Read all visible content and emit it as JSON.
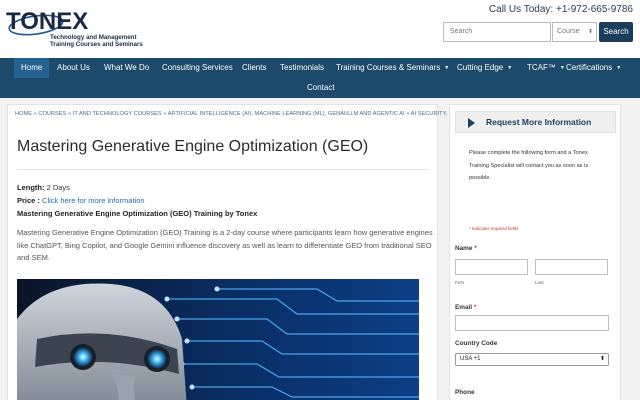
{
  "header": {
    "logo_word": "TONEX",
    "logo_line1": "Technology and Management",
    "logo_line2": "Training Courses and Seminars",
    "phone": "Call Us Today: +1-972-665-9786",
    "search_placeholder": "Search",
    "course_select": "Course",
    "search_button": "Search"
  },
  "nav": {
    "items": [
      {
        "label": "Home"
      },
      {
        "label": "About Us"
      },
      {
        "label": "What We Do"
      },
      {
        "label": "Consulting Services"
      },
      {
        "label": "Clients"
      },
      {
        "label": "Testimonials"
      },
      {
        "label": "Training Courses & Seminars"
      },
      {
        "label": "Cutting Edge"
      },
      {
        "label": "TCAF™"
      },
      {
        "label": "Certifications"
      },
      {
        "label": "Contact"
      }
    ],
    "caret": "▼"
  },
  "main": {
    "breadcrumb": "HOME » COURSES » IT AND TECHNOLOGY COURSES » ARTIFICIAL INTELLIGENCE (AI), MACHINE LEARNING (ML), GENAI/LLM AND AGENTIC AI » AI SECURITY,",
    "title": "Mastering Generative Engine Optimization (GEO)",
    "length_label": "Length:",
    "length_value": "2 Days",
    "price_label": "Price :",
    "price_link": "Click here for more information",
    "subtitle": "Mastering Generative Engine Optimization (GEO) Training by Tonex",
    "description": "Mastering Generative Engine Optimization (GEO) Training is a 2-day course where participants learn how generative engines like ChatGPT, Bing Copilot, and Google Gemini influence discovery as well as learn to differentiate GEO from traditional SEO and SEM."
  },
  "sidebar": {
    "title": "Request More Information",
    "intro": "Please complete the following form and a Tonex Training Specialist will contact you as soon as is possible.",
    "required_note": "* Indicates required fields",
    "name_label": "Name",
    "first_label": "First",
    "last_label": "Last",
    "email_label": "Email",
    "country_label": "Country Code",
    "country_value": "USA +1",
    "phone_label": "Phone",
    "star": "*"
  },
  "colors": {
    "nav_bg": "#1b4a6b",
    "nav_active": "#236291",
    "link": "#1f6fb2",
    "required": "#c0392b"
  }
}
